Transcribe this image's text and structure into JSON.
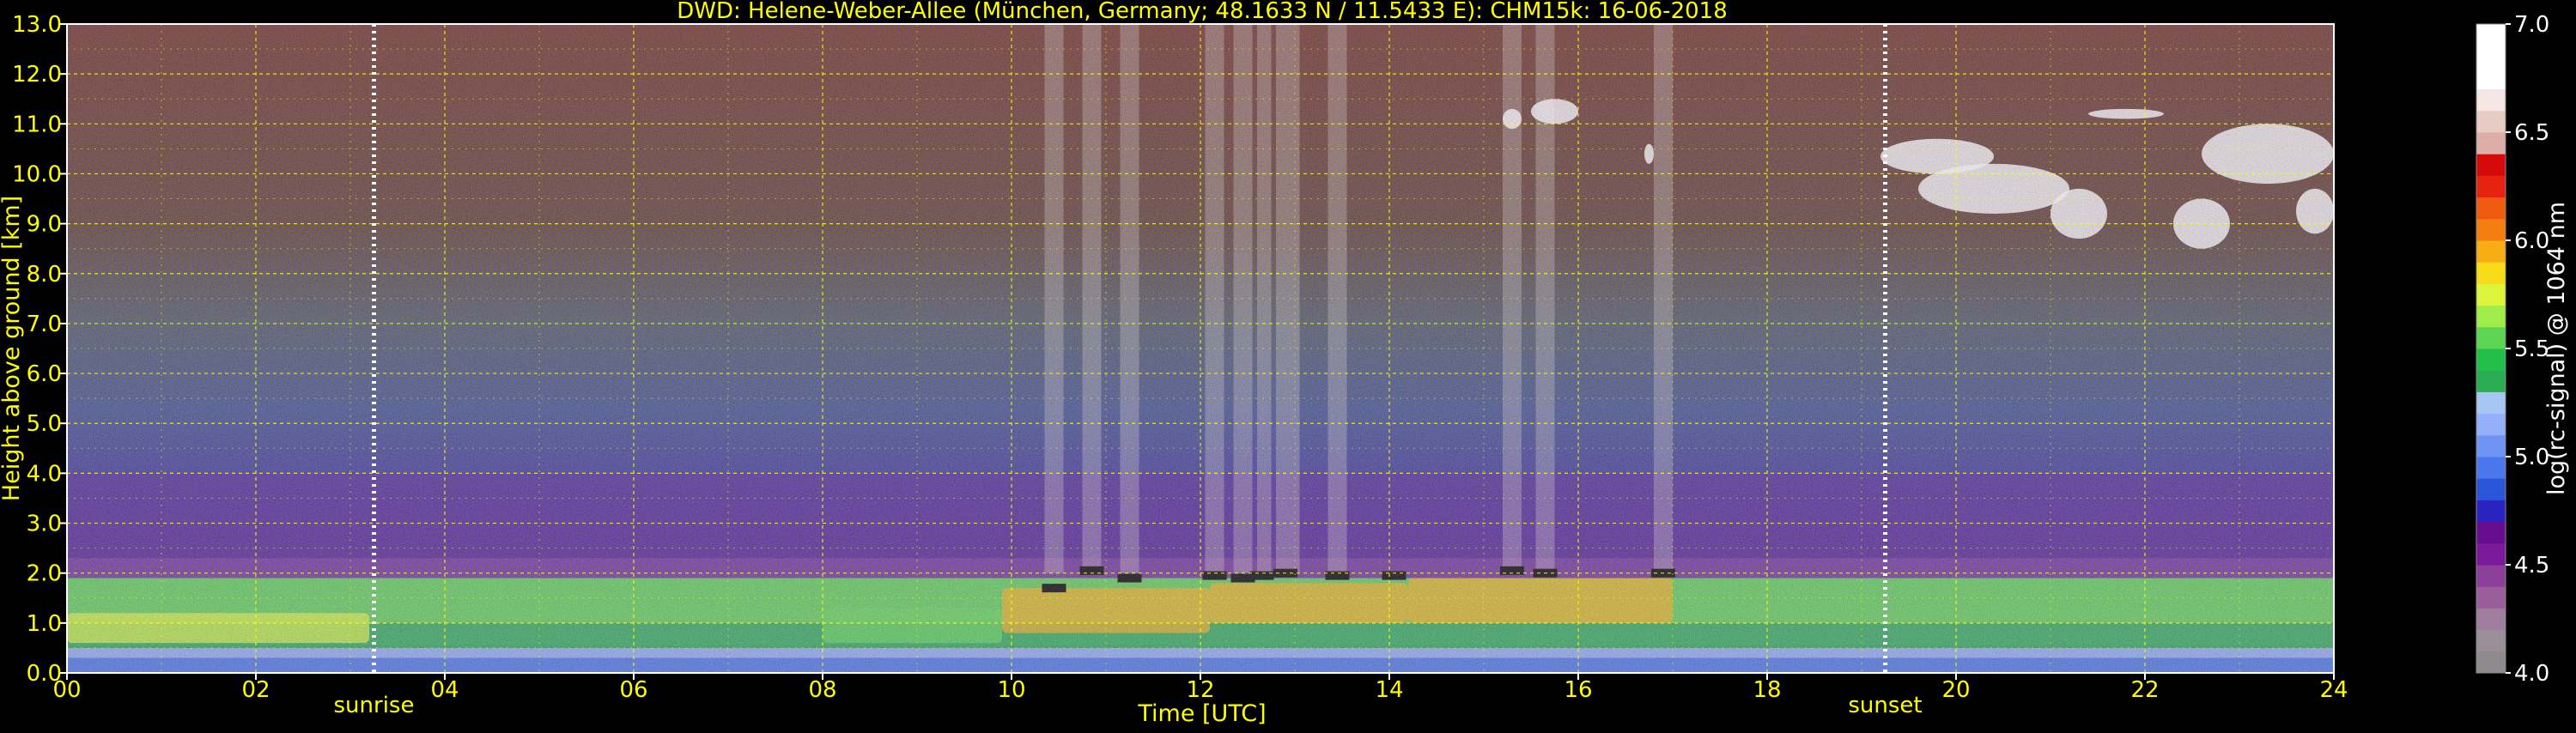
{
  "chart_data": {
    "type": "heatmap",
    "title": "DWD: Helene-Weber-Allee (München, Germany; 48.1633 N / 11.5433 E):    CHM15k: 16-06-2018",
    "xlabel": "Time [UTC]",
    "ylabel": "Height above ground [km]",
    "xlim": [
      0,
      24
    ],
    "ylim": [
      0,
      13
    ],
    "x_ticks": [
      "00",
      "02",
      "04",
      "06",
      "08",
      "10",
      "12",
      "14",
      "16",
      "18",
      "20",
      "22",
      "24"
    ],
    "y_ticks": [
      "0.0",
      "1.0",
      "2.0",
      "3.0",
      "4.0",
      "5.0",
      "6.0",
      "7.0",
      "8.0",
      "9.0",
      "10.0",
      "11.0",
      "12.0",
      "13.0"
    ],
    "x_minor_grid": [
      1,
      3,
      5,
      7,
      9,
      11,
      13,
      15,
      17,
      19,
      21,
      23
    ],
    "y_minor_grid": [
      0.5,
      1.5,
      2.5,
      3.5,
      4.5,
      5.5,
      6.5,
      7.5,
      8.5,
      9.5,
      10.5,
      11.5,
      12.5
    ],
    "grid": true,
    "colorbar": {
      "label": "log(rc-signal) @ 1064 nm",
      "range": [
        4.0,
        7.0
      ],
      "ticks": [
        "4.0",
        "4.5",
        "5.0",
        "5.5",
        "6.0",
        "6.5",
        "7.0"
      ],
      "colors": [
        "#8f8a8e",
        "#9a8f98",
        "#a07ea0",
        "#9a5e9a",
        "#8b3f98",
        "#7a1a9a",
        "#650c8f",
        "#2a23c2",
        "#2a55d8",
        "#4a78ec",
        "#6f94f6",
        "#94b0fa",
        "#a7c6f4",
        "#2aae55",
        "#22c04a",
        "#5dd552",
        "#a0ec48",
        "#dcf53c",
        "#f8dc18",
        "#f8ad14",
        "#f47e10",
        "#ee5b10",
        "#e62210",
        "#d60a0a",
        "#dbaea8",
        "#e7cbc5",
        "#f4e6e2",
        "#ffffff",
        "#ffffff",
        "#ffffff"
      ]
    },
    "annotations": [
      {
        "text": "sunrise",
        "x": 3.25
      },
      {
        "text": "sunset",
        "x": 19.25
      }
    ],
    "layers": [
      {
        "name": "surface",
        "y0": 0.0,
        "y1": 0.3,
        "color": "#4a78ec"
      },
      {
        "name": "boundary-layer-lower",
        "y0": 0.3,
        "y1": 0.5,
        "color": "#94b0fa"
      },
      {
        "name": "boundary-layer-middle",
        "y0": 0.5,
        "y1": 1.0,
        "color": "#2aae55"
      },
      {
        "name": "boundary-layer-upper",
        "y0": 1.0,
        "y1": 1.9,
        "color": "#5dd552"
      },
      {
        "name": "residual-layer",
        "y0": 1.9,
        "y1": 2.3,
        "color": "#8b3f98"
      },
      {
        "name": "low-troposphere",
        "y0": 2.3,
        "y1": 4.0,
        "color": "#5a1f8c"
      },
      {
        "name": "mid-troposphere",
        "y0": 4.0,
        "y1": 6.5,
        "color": "#3b3a9a"
      },
      {
        "name": "upper-troposphere",
        "y0": 6.5,
        "y1": 9.0,
        "color": "#4a5063"
      },
      {
        "name": "high-troposphere",
        "y0": 9.0,
        "y1": 13.0,
        "color": "#6a3326"
      }
    ],
    "high_signal_patches": [
      {
        "t0": 8.0,
        "t1": 9.9,
        "y0": 0.6,
        "y1": 1.3,
        "level": 5.6
      },
      {
        "t0": 9.9,
        "t1": 12.1,
        "y0": 0.8,
        "y1": 1.7,
        "level": 5.9
      },
      {
        "t0": 12.1,
        "t1": 14.2,
        "y0": 1.0,
        "y1": 1.8,
        "level": 5.9
      },
      {
        "t0": 14.2,
        "t1": 17.0,
        "y0": 1.0,
        "y1": 1.9,
        "level": 5.9
      },
      {
        "t0": 0.0,
        "t1": 3.2,
        "y0": 0.6,
        "y1": 1.2,
        "level": 5.7
      }
    ],
    "cloud_bases": [
      {
        "t": 10.45,
        "y": 1.7
      },
      {
        "t": 10.85,
        "y": 2.05
      },
      {
        "t": 11.25,
        "y": 1.9
      },
      {
        "t": 12.15,
        "y": 1.95
      },
      {
        "t": 12.45,
        "y": 1.9
      },
      {
        "t": 12.65,
        "y": 1.95
      },
      {
        "t": 12.9,
        "y": 2.0
      },
      {
        "t": 13.45,
        "y": 1.95
      },
      {
        "t": 14.05,
        "y": 1.95
      },
      {
        "t": 15.3,
        "y": 2.05
      },
      {
        "t": 15.65,
        "y": 2.0
      },
      {
        "t": 16.9,
        "y": 2.0
      }
    ],
    "precip_streaks": [
      {
        "t0": 10.35,
        "t1": 10.55
      },
      {
        "t0": 10.75,
        "t1": 10.95
      },
      {
        "t0": 11.15,
        "t1": 11.35
      },
      {
        "t0": 12.05,
        "t1": 12.25
      },
      {
        "t0": 12.35,
        "t1": 12.55
      },
      {
        "t0": 12.6,
        "t1": 12.75
      },
      {
        "t0": 12.8,
        "t1": 13.05
      },
      {
        "t0": 13.35,
        "t1": 13.55
      },
      {
        "t0": 15.2,
        "t1": 15.4
      },
      {
        "t0": 15.55,
        "t1": 15.75
      },
      {
        "t0": 16.8,
        "t1": 17.0
      }
    ],
    "clouds": [
      {
        "t0": 15.2,
        "t1": 15.4,
        "y0": 10.9,
        "y1": 11.3
      },
      {
        "t0": 15.5,
        "t1": 16.0,
        "y0": 11.0,
        "y1": 11.5
      },
      {
        "t0": 16.7,
        "t1": 16.8,
        "y0": 10.2,
        "y1": 10.6
      },
      {
        "t0": 19.2,
        "t1": 20.4,
        "y0": 10.0,
        "y1": 10.7
      },
      {
        "t0": 19.6,
        "t1": 21.2,
        "y0": 9.2,
        "y1": 10.2
      },
      {
        "t0": 21.0,
        "t1": 21.6,
        "y0": 8.7,
        "y1": 9.7
      },
      {
        "t0": 21.4,
        "t1": 22.2,
        "y0": 11.1,
        "y1": 11.3
      },
      {
        "t0": 22.3,
        "t1": 22.9,
        "y0": 8.5,
        "y1": 9.5
      },
      {
        "t0": 22.6,
        "t1": 24.0,
        "y0": 9.8,
        "y1": 11.0
      },
      {
        "t0": 23.6,
        "t1": 24.0,
        "y0": 8.8,
        "y1": 9.7
      }
    ],
    "colors": {
      "text": "#ffff00",
      "axis": "#ffffff",
      "grid": "#ffff00",
      "cloud_base": "#000000",
      "cloud": "#ffffff",
      "sun_marker": "#ffffff"
    }
  }
}
